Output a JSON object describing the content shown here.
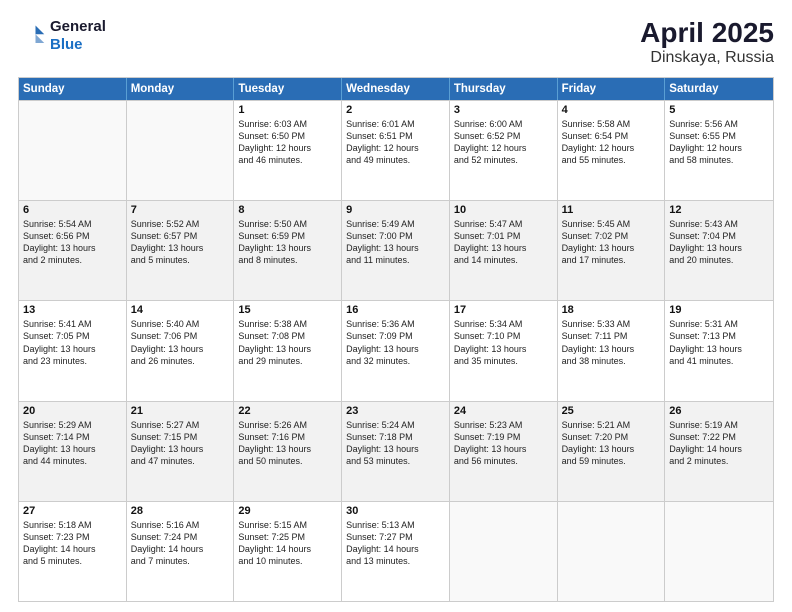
{
  "header": {
    "logo_line1": "General",
    "logo_line2": "Blue",
    "title": "April 2025",
    "subtitle": "Dinskaya, Russia"
  },
  "calendar": {
    "days_of_week": [
      "Sunday",
      "Monday",
      "Tuesday",
      "Wednesday",
      "Thursday",
      "Friday",
      "Saturday"
    ],
    "weeks": [
      [
        {
          "day": "",
          "lines": [],
          "empty": true
        },
        {
          "day": "",
          "lines": [],
          "empty": true
        },
        {
          "day": "1",
          "lines": [
            "Sunrise: 6:03 AM",
            "Sunset: 6:50 PM",
            "Daylight: 12 hours",
            "and 46 minutes."
          ]
        },
        {
          "day": "2",
          "lines": [
            "Sunrise: 6:01 AM",
            "Sunset: 6:51 PM",
            "Daylight: 12 hours",
            "and 49 minutes."
          ]
        },
        {
          "day": "3",
          "lines": [
            "Sunrise: 6:00 AM",
            "Sunset: 6:52 PM",
            "Daylight: 12 hours",
            "and 52 minutes."
          ]
        },
        {
          "day": "4",
          "lines": [
            "Sunrise: 5:58 AM",
            "Sunset: 6:54 PM",
            "Daylight: 12 hours",
            "and 55 minutes."
          ]
        },
        {
          "day": "5",
          "lines": [
            "Sunrise: 5:56 AM",
            "Sunset: 6:55 PM",
            "Daylight: 12 hours",
            "and 58 minutes."
          ]
        }
      ],
      [
        {
          "day": "6",
          "lines": [
            "Sunrise: 5:54 AM",
            "Sunset: 6:56 PM",
            "Daylight: 13 hours",
            "and 2 minutes."
          ]
        },
        {
          "day": "7",
          "lines": [
            "Sunrise: 5:52 AM",
            "Sunset: 6:57 PM",
            "Daylight: 13 hours",
            "and 5 minutes."
          ]
        },
        {
          "day": "8",
          "lines": [
            "Sunrise: 5:50 AM",
            "Sunset: 6:59 PM",
            "Daylight: 13 hours",
            "and 8 minutes."
          ]
        },
        {
          "day": "9",
          "lines": [
            "Sunrise: 5:49 AM",
            "Sunset: 7:00 PM",
            "Daylight: 13 hours",
            "and 11 minutes."
          ]
        },
        {
          "day": "10",
          "lines": [
            "Sunrise: 5:47 AM",
            "Sunset: 7:01 PM",
            "Daylight: 13 hours",
            "and 14 minutes."
          ]
        },
        {
          "day": "11",
          "lines": [
            "Sunrise: 5:45 AM",
            "Sunset: 7:02 PM",
            "Daylight: 13 hours",
            "and 17 minutes."
          ]
        },
        {
          "day": "12",
          "lines": [
            "Sunrise: 5:43 AM",
            "Sunset: 7:04 PM",
            "Daylight: 13 hours",
            "and 20 minutes."
          ]
        }
      ],
      [
        {
          "day": "13",
          "lines": [
            "Sunrise: 5:41 AM",
            "Sunset: 7:05 PM",
            "Daylight: 13 hours",
            "and 23 minutes."
          ]
        },
        {
          "day": "14",
          "lines": [
            "Sunrise: 5:40 AM",
            "Sunset: 7:06 PM",
            "Daylight: 13 hours",
            "and 26 minutes."
          ]
        },
        {
          "day": "15",
          "lines": [
            "Sunrise: 5:38 AM",
            "Sunset: 7:08 PM",
            "Daylight: 13 hours",
            "and 29 minutes."
          ]
        },
        {
          "day": "16",
          "lines": [
            "Sunrise: 5:36 AM",
            "Sunset: 7:09 PM",
            "Daylight: 13 hours",
            "and 32 minutes."
          ]
        },
        {
          "day": "17",
          "lines": [
            "Sunrise: 5:34 AM",
            "Sunset: 7:10 PM",
            "Daylight: 13 hours",
            "and 35 minutes."
          ]
        },
        {
          "day": "18",
          "lines": [
            "Sunrise: 5:33 AM",
            "Sunset: 7:11 PM",
            "Daylight: 13 hours",
            "and 38 minutes."
          ]
        },
        {
          "day": "19",
          "lines": [
            "Sunrise: 5:31 AM",
            "Sunset: 7:13 PM",
            "Daylight: 13 hours",
            "and 41 minutes."
          ]
        }
      ],
      [
        {
          "day": "20",
          "lines": [
            "Sunrise: 5:29 AM",
            "Sunset: 7:14 PM",
            "Daylight: 13 hours",
            "and 44 minutes."
          ]
        },
        {
          "day": "21",
          "lines": [
            "Sunrise: 5:27 AM",
            "Sunset: 7:15 PM",
            "Daylight: 13 hours",
            "and 47 minutes."
          ]
        },
        {
          "day": "22",
          "lines": [
            "Sunrise: 5:26 AM",
            "Sunset: 7:16 PM",
            "Daylight: 13 hours",
            "and 50 minutes."
          ]
        },
        {
          "day": "23",
          "lines": [
            "Sunrise: 5:24 AM",
            "Sunset: 7:18 PM",
            "Daylight: 13 hours",
            "and 53 minutes."
          ]
        },
        {
          "day": "24",
          "lines": [
            "Sunrise: 5:23 AM",
            "Sunset: 7:19 PM",
            "Daylight: 13 hours",
            "and 56 minutes."
          ]
        },
        {
          "day": "25",
          "lines": [
            "Sunrise: 5:21 AM",
            "Sunset: 7:20 PM",
            "Daylight: 13 hours",
            "and 59 minutes."
          ]
        },
        {
          "day": "26",
          "lines": [
            "Sunrise: 5:19 AM",
            "Sunset: 7:22 PM",
            "Daylight: 14 hours",
            "and 2 minutes."
          ]
        }
      ],
      [
        {
          "day": "27",
          "lines": [
            "Sunrise: 5:18 AM",
            "Sunset: 7:23 PM",
            "Daylight: 14 hours",
            "and 5 minutes."
          ]
        },
        {
          "day": "28",
          "lines": [
            "Sunrise: 5:16 AM",
            "Sunset: 7:24 PM",
            "Daylight: 14 hours",
            "and 7 minutes."
          ]
        },
        {
          "day": "29",
          "lines": [
            "Sunrise: 5:15 AM",
            "Sunset: 7:25 PM",
            "Daylight: 14 hours",
            "and 10 minutes."
          ]
        },
        {
          "day": "30",
          "lines": [
            "Sunrise: 5:13 AM",
            "Sunset: 7:27 PM",
            "Daylight: 14 hours",
            "and 13 minutes."
          ]
        },
        {
          "day": "",
          "lines": [],
          "empty": true
        },
        {
          "day": "",
          "lines": [],
          "empty": true
        },
        {
          "day": "",
          "lines": [],
          "empty": true
        }
      ]
    ]
  }
}
